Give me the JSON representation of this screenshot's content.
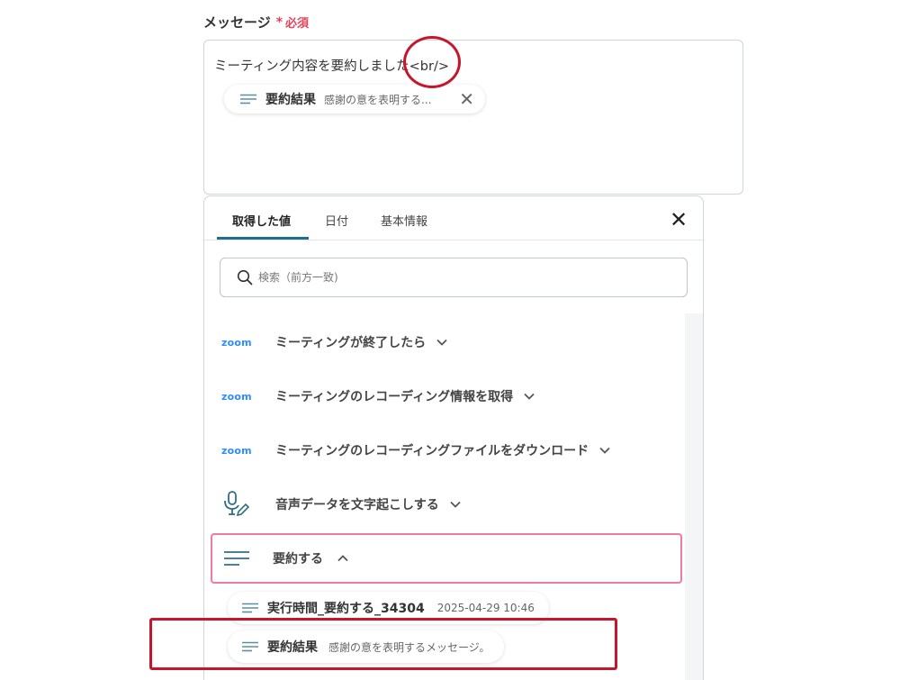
{
  "field": {
    "label": "メッセージ",
    "required_mark": "*",
    "required_text": "必須"
  },
  "message": {
    "text": "ミーティング内容を要約しました<br/>",
    "chip": {
      "title": "要約結果",
      "preview": "感謝の意を表明する..."
    }
  },
  "panel": {
    "tabs": [
      {
        "label": "取得した値",
        "active": true
      },
      {
        "label": "日付",
        "active": false
      },
      {
        "label": "基本情報",
        "active": false
      }
    ],
    "search_placeholder": "検索（前方一致)",
    "sections": [
      {
        "logo": "zoom",
        "label": "ミーティングが終了したら",
        "icon": "zoom-logo",
        "expanded": false
      },
      {
        "logo": "zoom",
        "label": "ミーティングのレコーディング情報を取得",
        "icon": "zoom-logo",
        "expanded": false
      },
      {
        "logo": "zoom",
        "label": "ミーティングのレコーディングファイルをダウンロード",
        "icon": "zoom-logo",
        "expanded": false
      },
      {
        "label": "音声データを文字起こしする",
        "icon": "microphone-pen-icon",
        "expanded": false
      },
      {
        "label": "要約する",
        "icon": "lines-icon",
        "expanded": true
      }
    ],
    "results": [
      {
        "title": "実行時間_要約する_34304",
        "value": "2025-04-29 10:46"
      },
      {
        "title": "要約結果",
        "value": "感謝の意を表明するメッセージ。"
      }
    ]
  },
  "colors": {
    "accent": "#1f6f8b",
    "required": "#e2455b",
    "annotation": "#c7162b",
    "highlight_border": "#f07aa3",
    "zoom_blue": "#2d8cff"
  }
}
